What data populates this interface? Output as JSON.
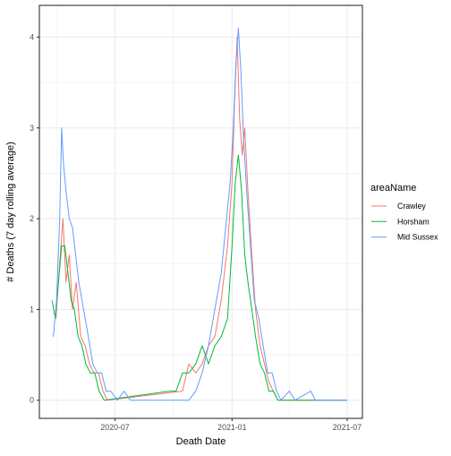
{
  "chart_data": {
    "type": "line",
    "xlabel": "Death Date",
    "ylabel": "# Deaths (7 day rolling average)",
    "x_ticks": [
      "2020-07",
      "2021-01",
      "2021-07"
    ],
    "y_ticks": [
      "0",
      "1",
      "2",
      "3",
      "4"
    ],
    "xlim": [
      "2020-03-04",
      "2021-07-25"
    ],
    "ylim": [
      -0.2,
      4.35
    ],
    "grid": true,
    "legend": {
      "title": "areaName",
      "position": "right"
    },
    "series": [
      {
        "name": "Crawley",
        "color": "#F8766D",
        "points": [
          [
            "2020-03-30",
            0.9
          ],
          [
            "2020-04-05",
            1.5
          ],
          [
            "2020-04-10",
            2.0
          ],
          [
            "2020-04-15",
            1.3
          ],
          [
            "2020-04-20",
            1.6
          ],
          [
            "2020-04-25",
            1.0
          ],
          [
            "2020-05-01",
            1.3
          ],
          [
            "2020-05-08",
            0.7
          ],
          [
            "2020-05-15",
            0.6
          ],
          [
            "2020-05-22",
            0.4
          ],
          [
            "2020-05-29",
            0.3
          ],
          [
            "2020-06-05",
            0.3
          ],
          [
            "2020-06-12",
            0.1
          ],
          [
            "2020-06-19",
            0.0
          ],
          [
            "2020-10-15",
            0.1
          ],
          [
            "2020-10-25",
            0.4
          ],
          [
            "2020-11-05",
            0.3
          ],
          [
            "2020-11-15",
            0.4
          ],
          [
            "2020-11-25",
            0.6
          ],
          [
            "2020-12-05",
            0.7
          ],
          [
            "2020-12-15",
            1.1
          ],
          [
            "2020-12-25",
            1.7
          ],
          [
            "2021-01-01",
            2.4
          ],
          [
            "2021-01-05",
            3.3
          ],
          [
            "2021-01-09",
            4.0
          ],
          [
            "2021-01-13",
            3.1
          ],
          [
            "2021-01-17",
            2.7
          ],
          [
            "2021-01-21",
            3.0
          ],
          [
            "2021-01-26",
            2.3
          ],
          [
            "2021-02-01",
            1.6
          ],
          [
            "2021-02-07",
            1.0
          ],
          [
            "2021-02-14",
            0.6
          ],
          [
            "2021-02-21",
            0.4
          ],
          [
            "2021-02-28",
            0.2
          ],
          [
            "2021-03-07",
            0.1
          ],
          [
            "2021-03-14",
            0.0
          ],
          [
            "2021-07-01",
            0.0
          ]
        ]
      },
      {
        "name": "Horsham",
        "color": "#00BA38",
        "points": [
          [
            "2020-03-24",
            1.1
          ],
          [
            "2020-03-29",
            0.9
          ],
          [
            "2020-04-03",
            1.3
          ],
          [
            "2020-04-08",
            1.7
          ],
          [
            "2020-04-13",
            1.7
          ],
          [
            "2020-04-18",
            1.4
          ],
          [
            "2020-04-23",
            1.1
          ],
          [
            "2020-04-28",
            1.0
          ],
          [
            "2020-05-04",
            0.7
          ],
          [
            "2020-05-10",
            0.6
          ],
          [
            "2020-05-16",
            0.4
          ],
          [
            "2020-05-23",
            0.3
          ],
          [
            "2020-05-30",
            0.3
          ],
          [
            "2020-06-06",
            0.1
          ],
          [
            "2020-06-14",
            0.0
          ],
          [
            "2020-09-25",
            0.1
          ],
          [
            "2020-10-05",
            0.1
          ],
          [
            "2020-10-15",
            0.3
          ],
          [
            "2020-10-25",
            0.3
          ],
          [
            "2020-11-05",
            0.4
          ],
          [
            "2020-11-15",
            0.6
          ],
          [
            "2020-11-25",
            0.4
          ],
          [
            "2020-12-05",
            0.6
          ],
          [
            "2020-12-15",
            0.7
          ],
          [
            "2020-12-25",
            0.9
          ],
          [
            "2021-01-01",
            1.7
          ],
          [
            "2021-01-06",
            2.4
          ],
          [
            "2021-01-11",
            2.7
          ],
          [
            "2021-01-16",
            2.3
          ],
          [
            "2021-01-21",
            1.6
          ],
          [
            "2021-01-26",
            1.3
          ],
          [
            "2021-02-01",
            1.0
          ],
          [
            "2021-02-07",
            0.7
          ],
          [
            "2021-02-14",
            0.4
          ],
          [
            "2021-02-21",
            0.3
          ],
          [
            "2021-02-28",
            0.1
          ],
          [
            "2021-03-07",
            0.1
          ],
          [
            "2021-03-14",
            0.0
          ],
          [
            "2021-07-01",
            0.0
          ]
        ]
      },
      {
        "name": "Mid Sussex",
        "color": "#619CFF",
        "points": [
          [
            "2020-03-26",
            0.7
          ],
          [
            "2020-03-31",
            1.1
          ],
          [
            "2020-04-05",
            2.0
          ],
          [
            "2020-04-08",
            3.0
          ],
          [
            "2020-04-11",
            2.6
          ],
          [
            "2020-04-15",
            2.3
          ],
          [
            "2020-04-20",
            2.0
          ],
          [
            "2020-04-25",
            1.9
          ],
          [
            "2020-04-30",
            1.6
          ],
          [
            "2020-05-05",
            1.3
          ],
          [
            "2020-05-10",
            1.1
          ],
          [
            "2020-05-15",
            0.9
          ],
          [
            "2020-05-20",
            0.7
          ],
          [
            "2020-05-27",
            0.4
          ],
          [
            "2020-06-03",
            0.3
          ],
          [
            "2020-06-10",
            0.3
          ],
          [
            "2020-06-17",
            0.1
          ],
          [
            "2020-06-24",
            0.1
          ],
          [
            "2020-07-05",
            0.0
          ],
          [
            "2020-07-15",
            0.1
          ],
          [
            "2020-07-25",
            0.0
          ],
          [
            "2020-10-25",
            0.0
          ],
          [
            "2020-11-05",
            0.1
          ],
          [
            "2020-11-15",
            0.3
          ],
          [
            "2020-11-25",
            0.6
          ],
          [
            "2020-12-05",
            1.0
          ],
          [
            "2020-12-15",
            1.4
          ],
          [
            "2020-12-22",
            1.9
          ],
          [
            "2020-12-29",
            2.4
          ],
          [
            "2021-01-03",
            3.0
          ],
          [
            "2021-01-07",
            3.7
          ],
          [
            "2021-01-11",
            4.1
          ],
          [
            "2021-01-15",
            3.6
          ],
          [
            "2021-01-19",
            2.9
          ],
          [
            "2021-01-24",
            2.3
          ],
          [
            "2021-01-30",
            1.7
          ],
          [
            "2021-02-05",
            1.1
          ],
          [
            "2021-02-12",
            0.9
          ],
          [
            "2021-02-19",
            0.6
          ],
          [
            "2021-02-26",
            0.3
          ],
          [
            "2021-03-05",
            0.3
          ],
          [
            "2021-03-12",
            0.1
          ],
          [
            "2021-03-19",
            0.0
          ],
          [
            "2021-04-01",
            0.1
          ],
          [
            "2021-04-10",
            0.0
          ],
          [
            "2021-05-05",
            0.1
          ],
          [
            "2021-05-12",
            0.0
          ],
          [
            "2021-07-01",
            0.0
          ]
        ]
      }
    ]
  }
}
